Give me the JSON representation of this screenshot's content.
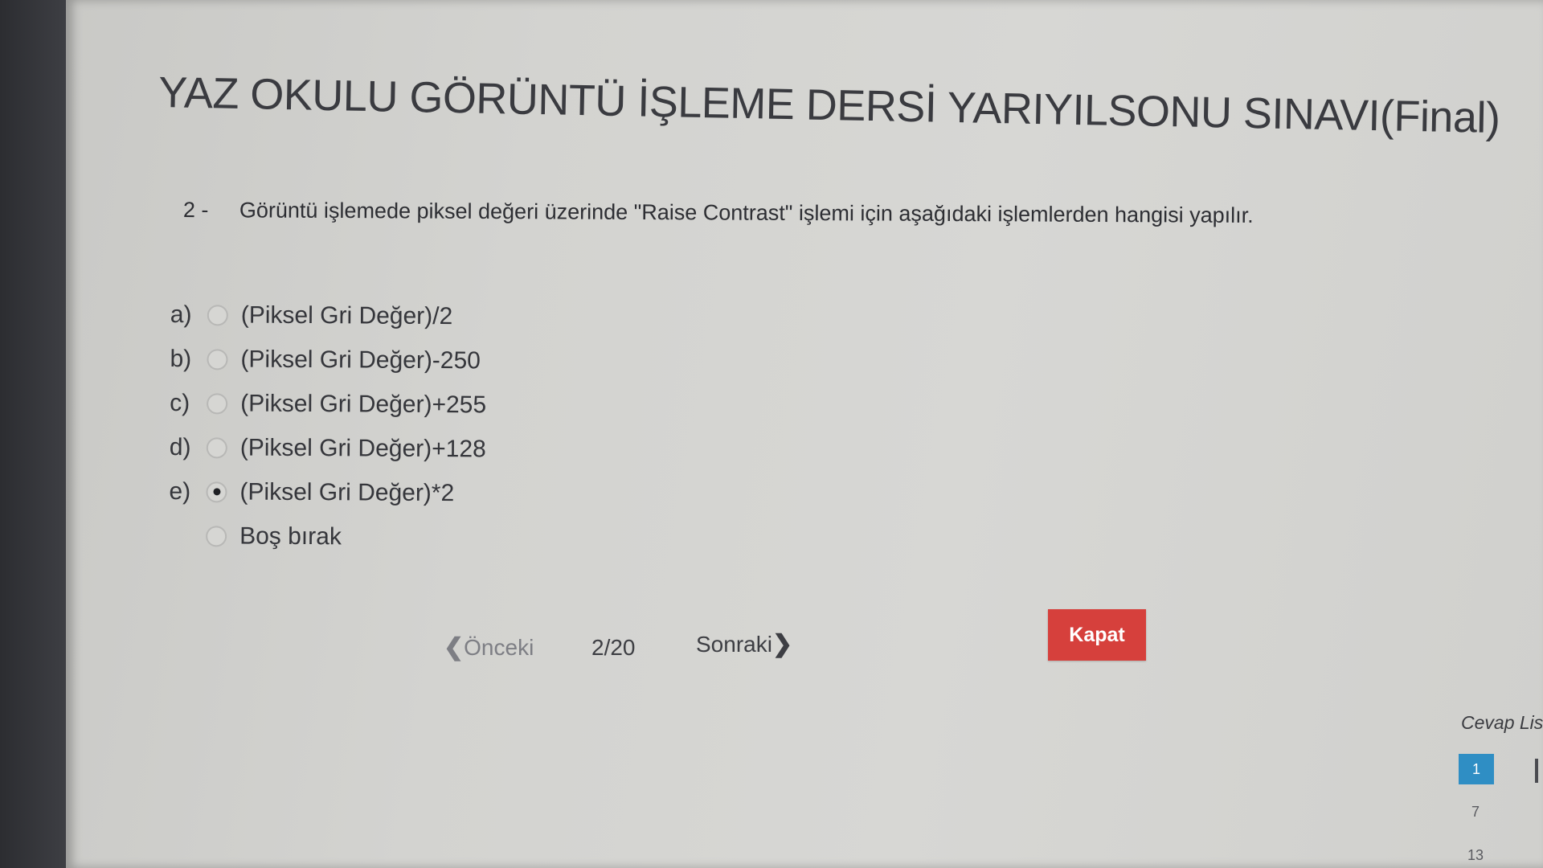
{
  "exam": {
    "title": "YAZ OKULU GÖRÜNTÜ İŞLEME DERSİ YARIYILSONU SINAVI(Final)"
  },
  "question": {
    "number": "2 -",
    "text": "Görüntü işlemede piksel değeri üzerinde \"Raise Contrast\" işlemi için aşağıdaki işlemlerden hangisi yapılır."
  },
  "options": [
    {
      "letter": "a)",
      "text": "(Piksel Gri Değer)/2",
      "selected": false
    },
    {
      "letter": "b)",
      "text": "(Piksel Gri Değer)-250",
      "selected": false
    },
    {
      "letter": "c)",
      "text": "(Piksel Gri Değer)+255",
      "selected": false
    },
    {
      "letter": "d)",
      "text": "(Piksel Gri Değer)+128",
      "selected": false
    },
    {
      "letter": "e)",
      "text": "(Piksel Gri Değer)*2",
      "selected": true
    },
    {
      "letter": "",
      "text": "Boş bırak",
      "selected": false
    }
  ],
  "navigation": {
    "prev_label": "Önceki",
    "page_indicator": "2/20",
    "next_label": "Sonraki"
  },
  "close_button": "Kapat",
  "answer_list": {
    "label": "Cevap Lis",
    "items": [
      "1",
      "7",
      "13"
    ],
    "active_color": "#2f8ec4"
  },
  "colors": {
    "close_button_bg": "#d6403c",
    "background": "#d3d3d0"
  }
}
